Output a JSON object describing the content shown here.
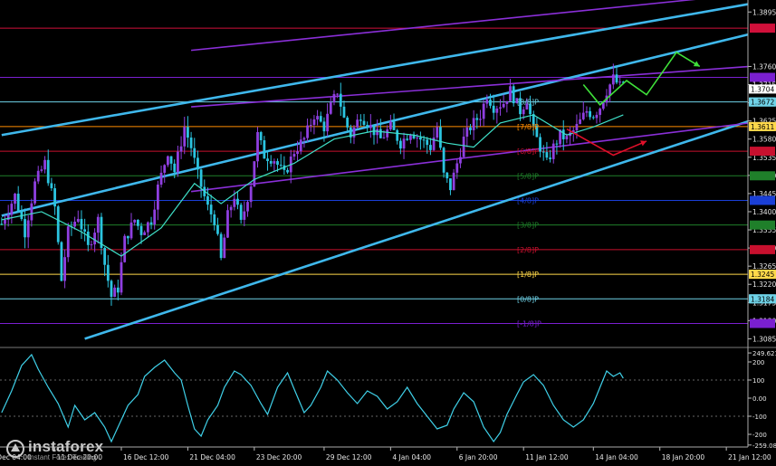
{
  "chart_data": {
    "type": "line",
    "title": "",
    "price_axis": {
      "ticks": [
        {
          "label": "1.3895",
          "value": 1.3895
        },
        {
          "label": "1.3760",
          "value": 1.376
        },
        {
          "label": "1.3715",
          "value": 1.3715
        },
        {
          "label": "1.3670",
          "value": 1.367
        },
        {
          "label": "1.3625",
          "value": 1.3625
        },
        {
          "label": "1.3580",
          "value": 1.358
        },
        {
          "label": "1.3535",
          "value": 1.3535
        },
        {
          "label": "1.3490",
          "value": 1.349
        },
        {
          "label": "1.3445",
          "value": 1.3445
        },
        {
          "label": "1.3400",
          "value": 1.34
        },
        {
          "label": "1.3355",
          "value": 1.3355
        },
        {
          "label": "1.3310",
          "value": 1.331
        },
        {
          "label": "1.3265",
          "value": 1.3265
        },
        {
          "label": "1.3220",
          "value": 1.322
        },
        {
          "label": "1.3175",
          "value": 1.3175
        },
        {
          "label": "1.3130",
          "value": 1.313
        },
        {
          "label": "1.3085",
          "value": 1.3085
        }
      ],
      "range": [
        1.3068,
        1.3918
      ]
    },
    "price_markers": [
      {
        "label": "1.3704",
        "value": 1.3704,
        "bg": "#ffffff",
        "fg": "#000000"
      },
      {
        "label": "1.3672",
        "value": 1.3672,
        "bg": "#6fd3e8",
        "fg": "#000000"
      },
      {
        "label": "1.3611",
        "value": 1.3611,
        "bg": "#ffd84a",
        "fg": "#000000"
      },
      {
        "label": "1.3245",
        "value": 1.3245,
        "bg": "#ffd84a",
        "fg": "#000000"
      },
      {
        "label": "1.3184",
        "value": 1.3184,
        "bg": "#6fd3e8",
        "fg": "#000000"
      }
    ],
    "murrey_levels": [
      {
        "label": "",
        "value": 1.3855,
        "color": "#d0103a",
        "badge_color": "#d0103a"
      },
      {
        "label": "",
        "value": 1.3733,
        "color": "#7a1fd0",
        "badge_color": "#7a1fd0"
      },
      {
        "label": "[8/8]P",
        "value": 1.3672,
        "color": "#6fd3e8",
        "badge_color": "#6fd3e8"
      },
      {
        "label": "[7/8]P",
        "value": 1.3611,
        "color": "#ff8c00",
        "badge_color": "#ffd84a"
      },
      {
        "label": "[6/8]P",
        "value": 1.355,
        "color": "#c8102e",
        "badge_color": "#c8102e"
      },
      {
        "label": "[5/8]P",
        "value": 1.3489,
        "color": "#1f7f2a",
        "badge_color": "#1f7f2a"
      },
      {
        "label": "[4/8]P",
        "value": 1.3428,
        "color": "#1a3fd6",
        "badge_color": "#1a3fd6"
      },
      {
        "label": "[3/8]P",
        "value": 1.3367,
        "color": "#1f7f2a",
        "badge_color": "#1f7f2a"
      },
      {
        "label": "[2/8]P",
        "value": 1.3306,
        "color": "#c8102e",
        "badge_color": "#c8102e"
      },
      {
        "label": "[1/8]P",
        "value": 1.3245,
        "color": "#ffd84a",
        "badge_color": "#ffd84a"
      },
      {
        "label": "[0/8]P",
        "value": 1.3184,
        "color": "#6fd3e8",
        "badge_color": "#6fd3e8"
      },
      {
        "label": "[-1/8]P",
        "value": 1.3123,
        "color": "#7a1fd0",
        "badge_color": "#7a1fd0"
      }
    ],
    "x_axis": {
      "labels": [
        {
          "label": "9 Dec 04:00",
          "bar": -4
        },
        {
          "label": "11 Dec 20:00",
          "bar": 16
        },
        {
          "label": "16 Dec 12:00",
          "bar": 36
        },
        {
          "label": "21 Dec 04:00",
          "bar": 56
        },
        {
          "label": "23 Dec 20:00",
          "bar": 76
        },
        {
          "label": "29 Dec 12:00",
          "bar": 97
        },
        {
          "label": "4 Jan 04:00",
          "bar": 117
        },
        {
          "label": "6 Jan 20:00",
          "bar": 137
        },
        {
          "label": "11 Jan 12:00",
          "bar": 157
        },
        {
          "label": "14 Jan 04:00",
          "bar": 178
        },
        {
          "label": "18 Jan 20:00",
          "bar": 198
        },
        {
          "label": "21 Jan 12:00",
          "bar": 218
        }
      ],
      "bar_count": 225
    },
    "price_path": [
      [
        0,
        1.337
      ],
      [
        4,
        1.344
      ],
      [
        7,
        1.335
      ],
      [
        10,
        1.347
      ],
      [
        13,
        1.352
      ],
      [
        16,
        1.341
      ],
      [
        18,
        1.323
      ],
      [
        20,
        1.335
      ],
      [
        23,
        1.339
      ],
      [
        26,
        1.331
      ],
      [
        29,
        1.338
      ],
      [
        31,
        1.327
      ],
      [
        33,
        1.319
      ],
      [
        35,
        1.321
      ],
      [
        37,
        1.333
      ],
      [
        40,
        1.338
      ],
      [
        42,
        1.335
      ],
      [
        45,
        1.338
      ],
      [
        47,
        1.346
      ],
      [
        50,
        1.355
      ],
      [
        52,
        1.35
      ],
      [
        55,
        1.361
      ],
      [
        57,
        1.356
      ],
      [
        59,
        1.349
      ],
      [
        62,
        1.341
      ],
      [
        64,
        1.338
      ],
      [
        66,
        1.328
      ],
      [
        68,
        1.339
      ],
      [
        70,
        1.344
      ],
      [
        72,
        1.337
      ],
      [
        75,
        1.347
      ],
      [
        77,
        1.359
      ],
      [
        79,
        1.354
      ],
      [
        82,
        1.353
      ],
      [
        85,
        1.349
      ],
      [
        88,
        1.355
      ],
      [
        91,
        1.358
      ],
      [
        94,
        1.364
      ],
      [
        97,
        1.361
      ],
      [
        99,
        1.366
      ],
      [
        101,
        1.37
      ],
      [
        103,
        1.363
      ],
      [
        105,
        1.359
      ],
      [
        108,
        1.364
      ],
      [
        111,
        1.361
      ],
      [
        114,
        1.358
      ],
      [
        117,
        1.361
      ],
      [
        120,
        1.357
      ],
      [
        123,
        1.36
      ],
      [
        126,
        1.358
      ],
      [
        129,
        1.356
      ],
      [
        131,
        1.361
      ],
      [
        133,
        1.349
      ],
      [
        135,
        1.346
      ],
      [
        137,
        1.352
      ],
      [
        139,
        1.358
      ],
      [
        141,
        1.361
      ],
      [
        144,
        1.364
      ],
      [
        146,
        1.369
      ],
      [
        148,
        1.366
      ],
      [
        151,
        1.367
      ],
      [
        153,
        1.37
      ],
      [
        156,
        1.365
      ],
      [
        158,
        1.368
      ],
      [
        160,
        1.36
      ],
      [
        162,
        1.356
      ],
      [
        164,
        1.352
      ],
      [
        166,
        1.356
      ],
      [
        168,
        1.359
      ],
      [
        170,
        1.358
      ],
      [
        173,
        1.361
      ],
      [
        176,
        1.365
      ],
      [
        178,
        1.364
      ],
      [
        180,
        1.366
      ],
      [
        182,
        1.37
      ],
      [
        184,
        1.373
      ],
      [
        186,
        1.371
      ],
      [
        187,
        1.372
      ]
    ],
    "ma_path": [
      [
        0,
        1.338
      ],
      [
        12,
        1.34
      ],
      [
        24,
        1.335
      ],
      [
        36,
        1.329
      ],
      [
        48,
        1.336
      ],
      [
        58,
        1.347
      ],
      [
        66,
        1.342
      ],
      [
        76,
        1.348
      ],
      [
        88,
        1.352
      ],
      [
        100,
        1.358
      ],
      [
        112,
        1.36
      ],
      [
        124,
        1.359
      ],
      [
        134,
        1.357
      ],
      [
        142,
        1.356
      ],
      [
        150,
        1.362
      ],
      [
        160,
        1.364
      ],
      [
        170,
        1.359
      ],
      [
        178,
        1.361
      ],
      [
        187,
        1.364
      ]
    ],
    "channels": [
      {
        "color": "#3fb8ec",
        "width": 2.6,
        "from": [
          0,
          1.359
        ],
        "to": [
          225,
          1.3915
        ]
      },
      {
        "color": "#3fb8ec",
        "width": 2.6,
        "from": [
          0,
          1.339
        ],
        "to": [
          225,
          1.384
        ]
      },
      {
        "color": "#3fb8ec",
        "width": 2.6,
        "from": [
          25,
          1.3085
        ],
        "to": [
          225,
          1.3625
        ]
      },
      {
        "color": "#8a2fd8",
        "width": 1.6,
        "from": [
          57,
          1.38
        ],
        "to": [
          225,
          1.394
        ]
      },
      {
        "color": "#8a2fd8",
        "width": 1.6,
        "from": [
          57,
          1.366
        ],
        "to": [
          225,
          1.376
        ]
      },
      {
        "color": "#8a2fd8",
        "width": 1.6,
        "from": [
          57,
          1.345
        ],
        "to": [
          225,
          1.362
        ]
      }
    ],
    "forecast_arrows": [
      {
        "color": "#3fe03a",
        "points": [
          [
            175,
            1.3715
          ],
          [
            180,
            1.3665
          ],
          [
            188,
            1.3725
          ],
          [
            194,
            1.369
          ],
          [
            203,
            1.3795
          ],
          [
            210,
            1.376
          ]
        ]
      },
      {
        "color": "#e0102a",
        "points": [
          [
            170,
            1.3605
          ],
          [
            184,
            1.354
          ],
          [
            194,
            1.3575
          ]
        ]
      }
    ],
    "oscillator": {
      "name": "CCI",
      "ticks": [
        {
          "label": "249.6219",
          "value": 249.6
        },
        {
          "label": "200",
          "value": 200
        },
        {
          "label": "100",
          "value": 100
        },
        {
          "label": "0.00",
          "value": 0
        },
        {
          "label": "-100",
          "value": -100
        },
        {
          "label": "-200",
          "value": -200
        },
        {
          "label": "-259.084",
          "value": -259.1
        }
      ],
      "range": [
        -270,
        265
      ],
      "levels": [
        100,
        -100
      ],
      "values": [
        [
          0,
          -80
        ],
        [
          3,
          40
        ],
        [
          6,
          180
        ],
        [
          9,
          240
        ],
        [
          11,
          160
        ],
        [
          14,
          60
        ],
        [
          17,
          -30
        ],
        [
          20,
          -160
        ],
        [
          22,
          -40
        ],
        [
          25,
          -120
        ],
        [
          28,
          -80
        ],
        [
          31,
          -160
        ],
        [
          33,
          -240
        ],
        [
          36,
          -120
        ],
        [
          38,
          -40
        ],
        [
          41,
          20
        ],
        [
          43,
          120
        ],
        [
          46,
          170
        ],
        [
          49,
          210
        ],
        [
          52,
          140
        ],
        [
          54,
          100
        ],
        [
          56,
          -40
        ],
        [
          58,
          -170
        ],
        [
          60,
          -210
        ],
        [
          62,
          -120
        ],
        [
          65,
          -40
        ],
        [
          67,
          60
        ],
        [
          70,
          150
        ],
        [
          72,
          130
        ],
        [
          75,
          70
        ],
        [
          78,
          -30
        ],
        [
          80,
          -90
        ],
        [
          83,
          60
        ],
        [
          86,
          140
        ],
        [
          88,
          50
        ],
        [
          91,
          -80
        ],
        [
          93,
          -40
        ],
        [
          96,
          60
        ],
        [
          98,
          150
        ],
        [
          101,
          100
        ],
        [
          104,
          30
        ],
        [
          107,
          -30
        ],
        [
          110,
          40
        ],
        [
          113,
          10
        ],
        [
          116,
          -60
        ],
        [
          119,
          -20
        ],
        [
          122,
          60
        ],
        [
          125,
          -30
        ],
        [
          128,
          -100
        ],
        [
          131,
          -170
        ],
        [
          134,
          -150
        ],
        [
          136,
          -60
        ],
        [
          139,
          30
        ],
        [
          142,
          -20
        ],
        [
          145,
          -160
        ],
        [
          148,
          -240
        ],
        [
          150,
          -190
        ],
        [
          152,
          -90
        ],
        [
          155,
          20
        ],
        [
          157,
          90
        ],
        [
          160,
          130
        ],
        [
          163,
          70
        ],
        [
          166,
          -40
        ],
        [
          169,
          -120
        ],
        [
          172,
          -160
        ],
        [
          175,
          -120
        ],
        [
          178,
          -30
        ],
        [
          180,
          60
        ],
        [
          182,
          150
        ],
        [
          184,
          120
        ],
        [
          186,
          140
        ],
        [
          187,
          110
        ]
      ]
    }
  },
  "watermark": {
    "brand": "instaforex",
    "tagline": "Instant Forex Trading"
  }
}
